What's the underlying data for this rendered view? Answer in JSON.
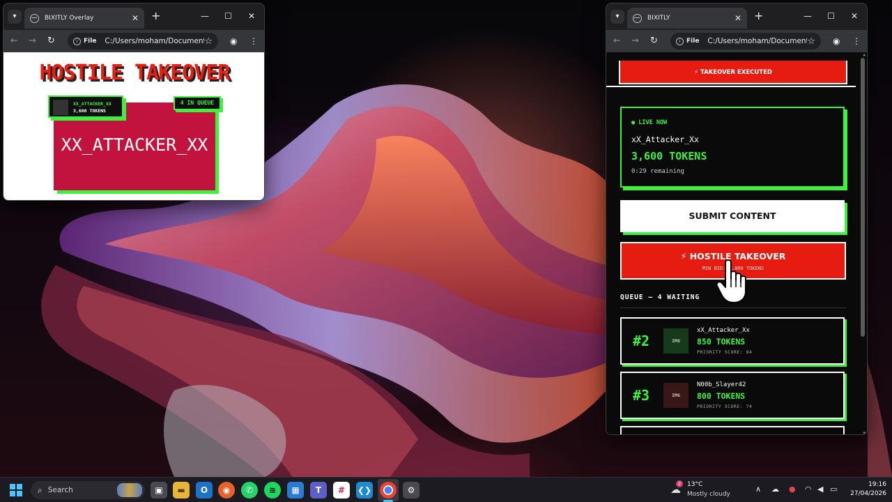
{
  "overlay_window": {
    "tab_title": "BIXITLY Overlay",
    "file_label": "File",
    "url": "C:/Users/moham/Document...",
    "headline": "HOSTILE TAKEOVER",
    "user_badge": {
      "name": "XX_ATTACKER_XX",
      "tokens": "3,600 TOKENS"
    },
    "queue_badge": "4 IN QUEUE",
    "card_name": "XX_ATTACKER_XX",
    "colors": {
      "headline": "#e52013",
      "card": "#c2133f",
      "accent": "#3df23d"
    }
  },
  "dashboard_window": {
    "tab_title": "BIXITLY",
    "file_label": "File",
    "url": "C:/Users/moham/Document...",
    "banner": "⚡  TAKEOVER EXECUTED",
    "live": {
      "tag": "● LIVE NOW",
      "name": "xX_Attacker_Xx",
      "tokens": "3,600 TOKENS",
      "remaining": "0:29 remaining"
    },
    "submit_button": "SUBMIT CONTENT",
    "hostile_button": {
      "label": "⚡ HOSTILE TAKEOVER",
      "sub": "MIN BID: 3,800 TOKENS"
    },
    "queue_title": "QUEUE — 4 WAITING",
    "queue": [
      {
        "rank": "#2",
        "thumb": "IMG",
        "thumb_color": "#17391c",
        "name": "xX_Attacker_Xx",
        "tokens": "850 TOKENS",
        "score": "PRIORITY SCORE: 84"
      },
      {
        "rank": "#3",
        "thumb": "IMG",
        "thumb_color": "#3a1717",
        "name": "N00b_Slayer42",
        "tokens": "800 TOKENS",
        "score": "PRIORITY SCORE: 74"
      }
    ],
    "colors": {
      "accent": "#3df23d",
      "danger": "#e51c0f",
      "bg": "#0a0a0a"
    }
  },
  "taskbar": {
    "search_placeholder": "Search",
    "apps": [
      "task-view-icon",
      "file-explorer-icon",
      "outlook-icon",
      "firefox-icon",
      "whatsapp-icon",
      "spotify-icon",
      "windows-app-icon",
      "teams-icon",
      "slack-icon",
      "vscode-icon",
      "chrome-icon",
      "settings-icon"
    ],
    "weather": {
      "badge": "2",
      "temp": "13°C",
      "desc": "Mostly cloudy"
    },
    "time": "19:16",
    "date": "27/04/2026"
  }
}
